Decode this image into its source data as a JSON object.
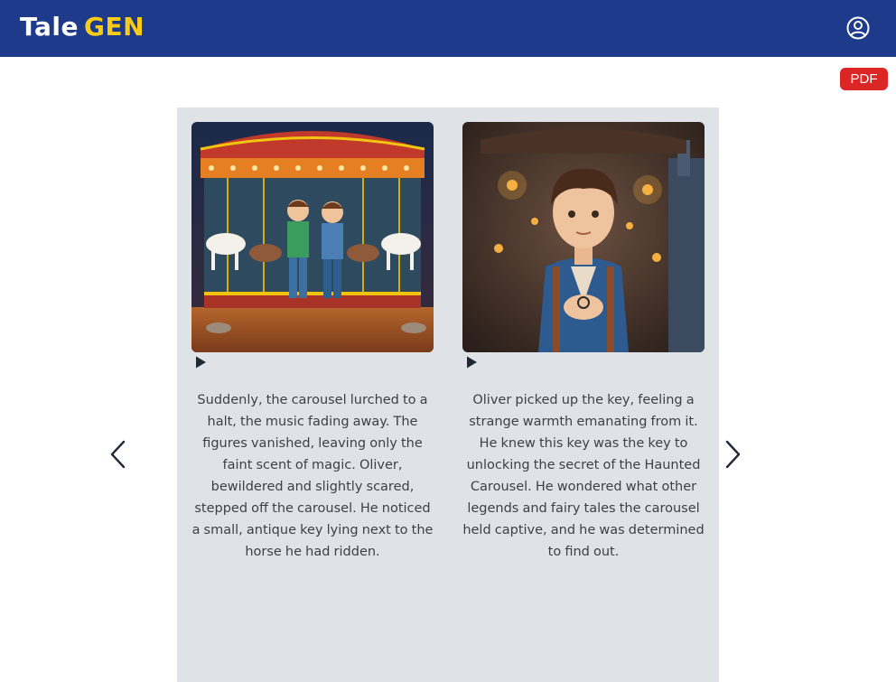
{
  "app": {
    "brand_tale": "Tale",
    "brand_gen": "GEN",
    "account_icon": "user-circle-icon"
  },
  "toolbar": {
    "pdf_label": "PDF"
  },
  "carousel": {
    "prev_icon": "chevron-left-icon",
    "next_icon": "chevron-right-icon",
    "cards": [
      {
        "image_icon": "carousel-two-boys-illustration",
        "play_icon": "play-icon",
        "text": "Suddenly, the carousel lurched to a halt, the music fading away. The figures vanished, leaving only the faint scent of magic. Oliver, bewildered and slightly scared, stepped off the carousel. He noticed a small, antique key lying next to the horse he had ridden."
      },
      {
        "image_icon": "boy-holding-key-illustration",
        "play_icon": "play-icon",
        "text": "Oliver picked up the key, feeling a strange warmth emanating from it. He knew this key was the key to unlocking the secret of the Haunted Carousel. He wondered what other legends and fairy tales the carousel held captive, and he was determined to find out."
      }
    ]
  },
  "colors": {
    "header_bg": "#1e3a8a",
    "brand_accent": "#facc15",
    "pdf_bg": "#dc2626",
    "carousel_bg": "#dfe3e8"
  }
}
